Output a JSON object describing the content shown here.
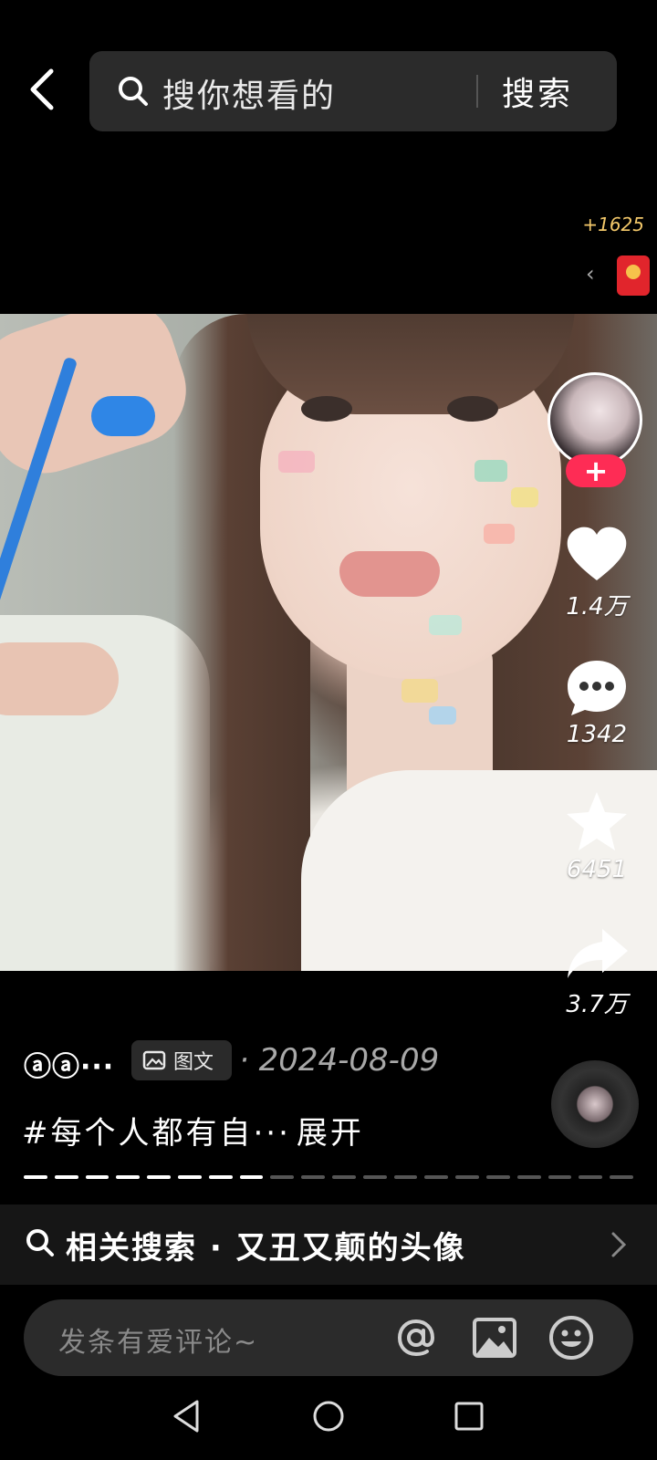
{
  "search": {
    "placeholder": "搜你想看的",
    "button": "搜索"
  },
  "reward": {
    "count": "+1625"
  },
  "actions": {
    "likes": "1.4万",
    "comments": "1342",
    "favorites": "6451",
    "shares": "3.7万",
    "follow": "+"
  },
  "post": {
    "author": "ⓐⓐ···",
    "type_label": "图文",
    "date": "· 2024-08-09",
    "caption": "#每个人都有自···",
    "expand": "展开"
  },
  "progress": {
    "total_pages": 20,
    "current_page": 8
  },
  "related": {
    "text": "相关搜索 · 又丑又颠的头像"
  },
  "comment": {
    "placeholder": "发条有爱评论~"
  },
  "colors": {
    "accent": "#fe2c55",
    "reward_gold": "#f3c86a"
  }
}
